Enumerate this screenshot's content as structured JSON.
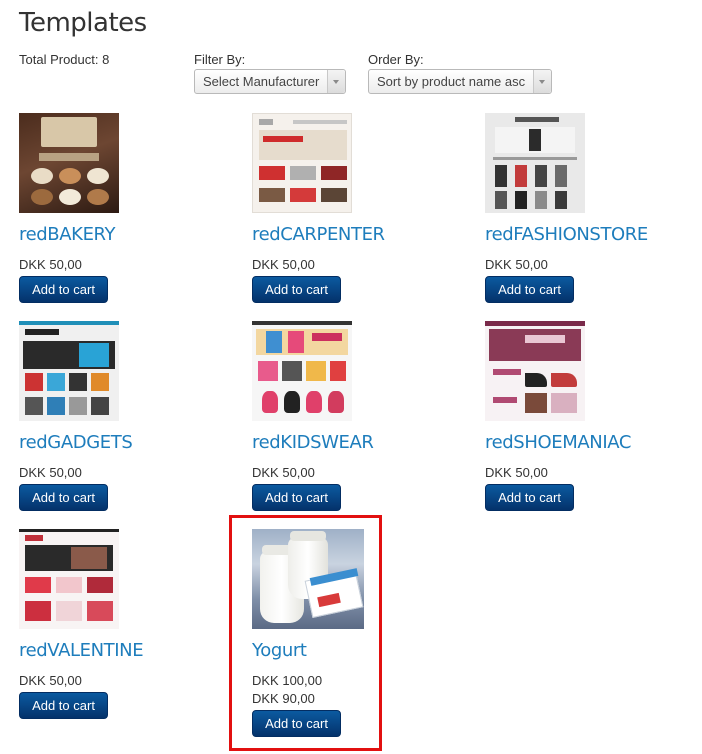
{
  "page": {
    "title": "Templates"
  },
  "toolbar": {
    "total_label": "Total Product: 8",
    "filter_label": "Filter By:",
    "filter_value": "Select Manufacturer",
    "order_label": "Order By:",
    "order_value": "Sort by product name asc"
  },
  "products": [
    {
      "name": "redBAKERY",
      "prices": [
        "DKK 50,00"
      ],
      "button": "Add to cart"
    },
    {
      "name": "redCARPENTER",
      "prices": [
        "DKK 50,00"
      ],
      "button": "Add to cart"
    },
    {
      "name": "redFASHIONSTORE",
      "prices": [
        "DKK 50,00"
      ],
      "button": "Add to cart"
    },
    {
      "name": "redGADGETS",
      "prices": [
        "DKK 50,00"
      ],
      "button": "Add to cart"
    },
    {
      "name": "redKIDSWEAR",
      "prices": [
        "DKK 50,00"
      ],
      "button": "Add to cart"
    },
    {
      "name": "redSHOEMANIAC",
      "prices": [
        "DKK 50,00"
      ],
      "button": "Add to cart"
    },
    {
      "name": "redVALENTINE",
      "prices": [
        "DKK 50,00"
      ],
      "button": "Add to cart"
    },
    {
      "name": "Yogurt",
      "prices": [
        "DKK 100,00",
        "DKK 90,00"
      ],
      "button": "Add to cart"
    }
  ],
  "colors": {
    "link": "#1e7dbc",
    "button": "#0b4a8c",
    "highlight": "#e21010"
  }
}
